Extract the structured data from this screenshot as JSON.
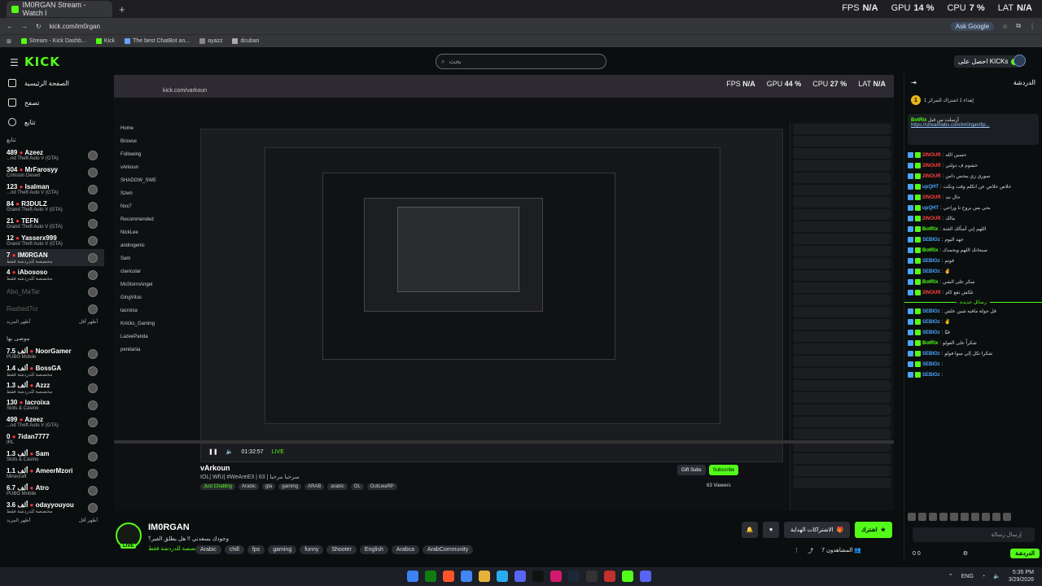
{
  "browser": {
    "tab_title": "IM0RGAN Stream - Watch l",
    "url": "kick.com/im0rgan",
    "ask_google": "Ask Google",
    "bookmarks": [
      "Stream - Kick Dashb...",
      "Kick",
      "The best ChatBot an...",
      "ayazz",
      "dcuban"
    ]
  },
  "hud": {
    "fps_label": "FPS",
    "fps": "N/A",
    "gpu_label": "GPU",
    "gpu": "14 %",
    "cpu_label": "CPU",
    "cpu": "7 %",
    "lat_label": "LAT",
    "lat": "N/A"
  },
  "header": {
    "logo": "KICK",
    "search_placeholder": "بحث",
    "get_kicks": "احصل على KICKs"
  },
  "sidebar": {
    "nav": [
      "الصفحة الرئيسية",
      "تصفح",
      "تتابع"
    ],
    "following_label": "تتابع",
    "following": [
      {
        "count": "489",
        "name": "Azeez",
        "game": "...nd Theft Auto V (GTA)"
      },
      {
        "count": "304",
        "name": "MrFarosyy",
        "game": "Crimson Desert"
      },
      {
        "count": "123",
        "name": "Isalman",
        "game": "...nd Theft Auto V (GTA)"
      },
      {
        "count": "84",
        "name": "R3DULZ",
        "game": "Grand Theft Auto V (GTA)"
      },
      {
        "count": "21",
        "name": "TEFN",
        "game": "Grand Theft Auto V (GTA)"
      },
      {
        "count": "12",
        "name": "Yasserx999",
        "game": "Grand Theft Auto V (GTA)"
      },
      {
        "count": "7",
        "name": "IM0RGAN",
        "game": "مخصصة للدردشة فقط"
      },
      {
        "count": "4",
        "name": "iAbososo",
        "game": "مخصصة للدردشة فقط"
      }
    ],
    "offline": [
      "Abo_MaTar",
      "Rashed7cr"
    ],
    "show_more": "أظهر المزيد",
    "show_less": "أظهر أقل",
    "recommended_label": "موصى بها",
    "recommended": [
      {
        "count": "7.5 ألف",
        "name": "NoorGamer",
        "game": "PUBG Mobile"
      },
      {
        "count": "1.4 ألف",
        "name": "BossGA",
        "game": "مخصصة للدردشة فقط"
      },
      {
        "count": "1.3 ألف",
        "name": "Azzz",
        "game": "مخصصة للدردشة فقط"
      },
      {
        "count": "130",
        "name": "lacroixa",
        "game": "Slots & Casino"
      },
      {
        "count": "499",
        "name": "Azeez",
        "game": "...nd Theft Auto V (GTA)"
      },
      {
        "count": "0",
        "name": "7idan7777",
        "game": "IRL"
      },
      {
        "count": "1.3 ألف",
        "name": "Sam",
        "game": "Slots & Casino"
      },
      {
        "count": "1.1 ألف",
        "name": "AmeerMzori",
        "game": "Minecraft"
      },
      {
        "count": "6.7 ألف",
        "name": "Atro",
        "game": "PUBG Mobile"
      },
      {
        "count": "3.6 ألف",
        "name": "odayyouyou",
        "game": "مخصصة للدردشة فقط"
      }
    ]
  },
  "embedded": {
    "url": "kick.com/varkoun",
    "fps": "N/A",
    "gpu": "44 %",
    "cpu": "27 %",
    "lat": "N/A",
    "side": [
      "Home",
      "Browse",
      "Following",
      "vArkoun",
      "SHADOW_SWE",
      "Szwn",
      "Nxx7",
      "Recommended",
      "NickLee",
      "androgenic",
      "Sam",
      "clavicular",
      "MsStormAngel",
      "GingVitus",
      "lacroixa",
      "Knicks_Gaming",
      "LazeePanda",
      "penitania"
    ],
    "stream_name": "vArkoun",
    "stream_title": "IOL| WfU| #WeAreE3 | 63 | سرحبا مرحبا",
    "category": "Just Chatting",
    "tags": [
      "Arabic",
      "gta",
      "gaming",
      "ARAB",
      "arabic",
      "OL",
      "OutLwaRP"
    ],
    "viewers": "63 Viewers",
    "time": "01:32:57",
    "live": "LIVE",
    "gift_subs": "Gift Subs",
    "subscribe": "Subscribe"
  },
  "stream": {
    "name": "IM0RGAN",
    "live": "LIVE",
    "title": "وجودك يسعدني !! هل يطلق الفير؟",
    "category": "مخصصة للدردشة فقط",
    "tags": [
      "Arabic",
      "chill",
      "fps",
      "gaming",
      "funny",
      "Shooter",
      "English",
      "Arabca",
      "ArabCommunity"
    ],
    "subscribe": "اشترك",
    "gift": "الاشتراكات الهداية",
    "viewers_label": "المشاهدون",
    "viewers": "7"
  },
  "chat": {
    "title": "الدردشة",
    "kicks_line": "إهداء 1 اشتراك للمركز 1",
    "pinned_user": "BotRix",
    "pinned_text": "أرسلت من قبل",
    "pinned_link": "https://streamlabs.com/im0rgan/tip...",
    "messages": [
      {
        "u": "2INOUR",
        "t": "حسين الله",
        "c": "#ff4040"
      },
      {
        "u": "2INOUR",
        "t": "خشوم ف دولتي",
        "c": "#ff4040"
      },
      {
        "u": "2INOUR",
        "t": "سوري زي يبحس داس",
        "c": "#ff4040"
      },
      {
        "u": "upQHT",
        "t": "خلاص خلاص عن اتكلم وقت ونكت",
        "c": "#4aa3ff"
      },
      {
        "u": "2INOUR",
        "t": "حال نبد",
        "c": "#ff4040"
      },
      {
        "u": "upQHT",
        "t": "بحي بس بروح نا وراحي",
        "c": "#4aa3ff"
      },
      {
        "u": "2INOUR",
        "t": "مالك",
        "c": "#ff4040"
      },
      {
        "u": "BotRix",
        "t": "اللهم إني أسألك الجنة",
        "c": "#53fc18"
      },
      {
        "u": "SEBIOz",
        "t": "جهد اليوم",
        "c": "#4aa3ff"
      },
      {
        "u": "BotRix",
        "t": "سبحانك اللهم وبحمدك",
        "c": "#53fc18"
      },
      {
        "u": "SEBIOz",
        "t": "قوتم",
        "c": "#4aa3ff"
      },
      {
        "u": "SEBIOz",
        "t": "✌",
        "c": "#4aa3ff"
      },
      {
        "u": "BotRix",
        "t": "سكر على الشي",
        "c": "#53fc18"
      },
      {
        "u": "2INOUR",
        "t": "تلكش تقع كام",
        "c": "#ff4040"
      }
    ],
    "new_messages": "رسائل جديدة",
    "messages2": [
      {
        "u": "SEBIOz",
        "t": "قل جولة مافيه شين علش",
        "c": "#4aa3ff"
      },
      {
        "u": "SEBIOz",
        "t": "✌",
        "c": "#4aa3ff"
      },
      {
        "u": "SEBIOz",
        "t": "قيّا",
        "c": "#4aa3ff"
      },
      {
        "u": "BotRix",
        "t": "شكراً على الفولو",
        "c": "#53fc18"
      },
      {
        "u": "SEBIOz",
        "t": "شكرا تكل إلي سوا فولو",
        "c": "#4aa3ff"
      },
      {
        "u": "SEBIOz",
        "t": "",
        "c": "#4aa3ff"
      },
      {
        "u": "SEBIOz",
        "t": "",
        "c": "#4aa3ff"
      }
    ],
    "input_placeholder": "إرسال رسالة",
    "send": "الدردشة",
    "kicks_count": "0",
    "points": "0"
  },
  "taskbar": {
    "lang": "ENG",
    "time": "5:35 PM",
    "date": "3/29/2026"
  }
}
